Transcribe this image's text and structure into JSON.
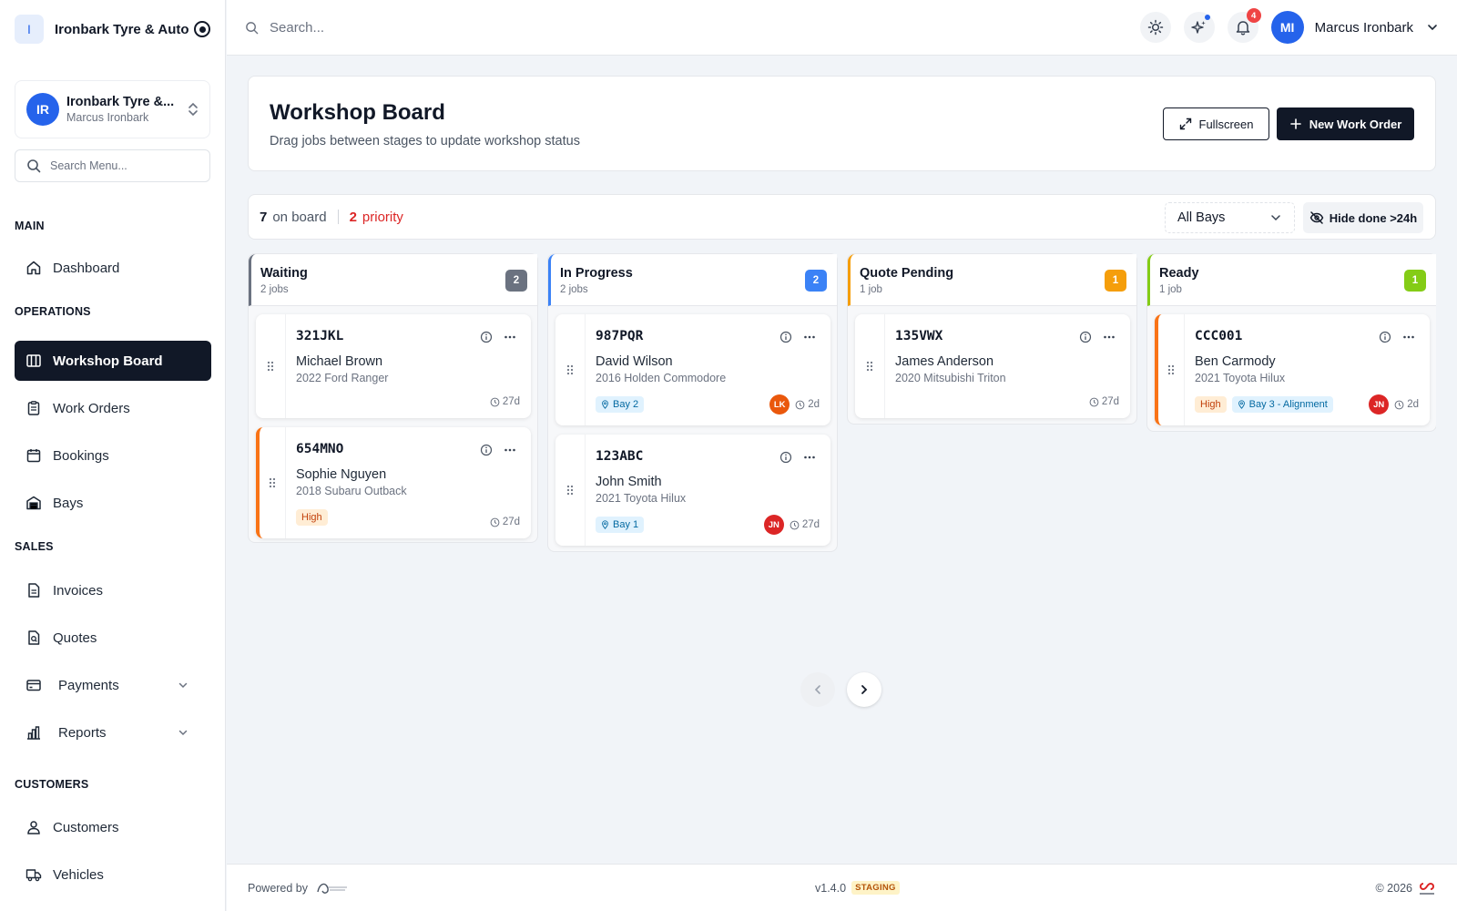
{
  "brand": {
    "logo_letter": "I",
    "name": "Ironbark Tyre & Auto"
  },
  "org": {
    "initials": "IR",
    "name": "Ironbark Tyre &...",
    "user": "Marcus Ironbark"
  },
  "menu_search": {
    "placeholder": "Search Menu..."
  },
  "sections": {
    "main": "MAIN",
    "operations": "OPERATIONS",
    "sales": "SALES",
    "customers": "CUSTOMERS"
  },
  "nav": {
    "dashboard": "Dashboard",
    "workshop_board": "Workshop Board",
    "work_orders": "Work Orders",
    "bookings": "Bookings",
    "bays": "Bays",
    "invoices": "Invoices",
    "quotes": "Quotes",
    "payments": "Payments",
    "reports": "Reports",
    "customers": "Customers",
    "vehicles": "Vehicles"
  },
  "topbar": {
    "search_placeholder": "Search...",
    "notifications_count": "4",
    "user_initials": "MI",
    "user_name": "Marcus Ironbark"
  },
  "header": {
    "title": "Workshop Board",
    "subtitle": "Drag jobs between stages to update workshop status",
    "fullscreen_label": "Fullscreen",
    "new_order_label": "New Work Order"
  },
  "stats": {
    "on_board_count": "7",
    "on_board_label": "on board",
    "priority_count": "2",
    "priority_label": "priority",
    "bay_filter": "All Bays",
    "hide_done_label": "Hide done >24h"
  },
  "columns": [
    {
      "title": "Waiting",
      "count_label": "2 jobs",
      "badge": "2",
      "color": "#6b7280",
      "cards": [
        {
          "plate": "321JKL",
          "customer": "Michael Brown",
          "vehicle": "2022 Ford Ranger",
          "age": "27d"
        },
        {
          "plate": "654MNO",
          "customer": "Sophie Nguyen",
          "vehicle": "2018 Subaru Outback",
          "priority": "High",
          "age": "27d"
        }
      ]
    },
    {
      "title": "In Progress",
      "count_label": "2 jobs",
      "badge": "2",
      "color": "#3b82f6",
      "cards": [
        {
          "plate": "987PQR",
          "customer": "David Wilson",
          "vehicle": "2016 Holden Commodore",
          "bay": "Bay 2",
          "tech": "LK",
          "age": "2d"
        },
        {
          "plate": "123ABC",
          "customer": "John Smith",
          "vehicle": "2021 Toyota Hilux",
          "bay": "Bay 1",
          "tech": "JN",
          "age": "27d"
        }
      ]
    },
    {
      "title": "Quote Pending",
      "count_label": "1 job",
      "badge": "1",
      "color": "#f59e0b",
      "cards": [
        {
          "plate": "135VWX",
          "customer": "James Anderson",
          "vehicle": "2020 Mitsubishi Triton",
          "age": "27d"
        }
      ]
    },
    {
      "title": "Ready",
      "count_label": "1 job",
      "badge": "1",
      "color": "#84cc16",
      "cards": [
        {
          "plate": "CCC001",
          "customer": "Ben Carmody",
          "vehicle": "2021 Toyota Hilux",
          "priority": "High",
          "bay": "Bay 3 - Alignment",
          "tech": "JN",
          "age": "2d"
        }
      ]
    }
  ],
  "footer": {
    "powered_by": "Powered by",
    "version": "v1.4.0",
    "env": "STAGING",
    "copyright": "© 2026"
  },
  "colors": {
    "accent": "#2563eb",
    "dark": "#111827",
    "priority": "#f97316",
    "tech_lk": "#ea580c",
    "tech_jn": "#dc2626"
  }
}
